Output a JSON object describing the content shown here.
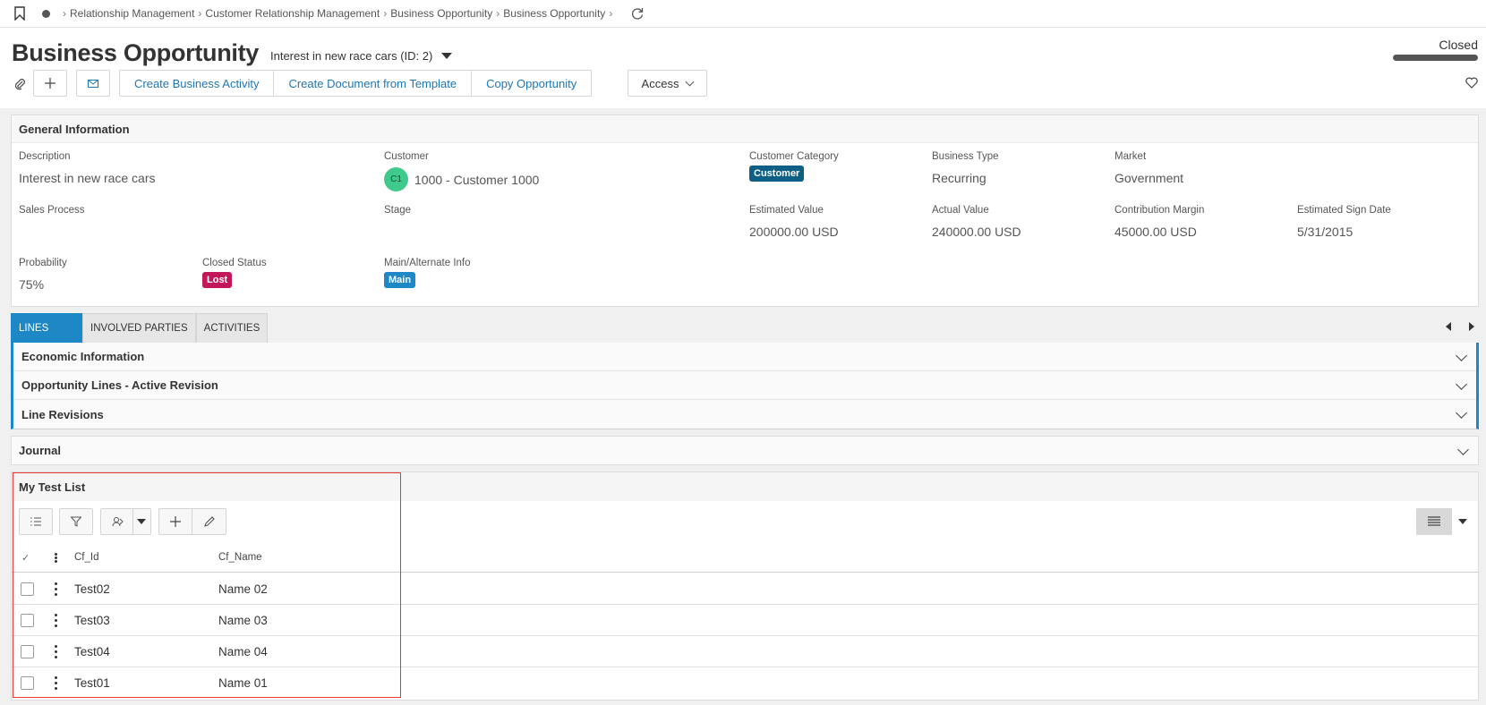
{
  "breadcrumb": {
    "items": [
      "Relationship Management",
      "Customer Relationship Management",
      "Business Opportunity",
      "Business Opportunity"
    ]
  },
  "page": {
    "title": "Business Opportunity",
    "subtitle": "Interest in new race cars (ID: 2)",
    "status": "Closed"
  },
  "toolbar": {
    "create_activity": "Create Business Activity",
    "create_document": "Create Document from Template",
    "copy_opportunity": "Copy Opportunity",
    "access": "Access"
  },
  "general": {
    "title": "General Information",
    "description_label": "Description",
    "description_value": "Interest in new race cars",
    "customer_label": "Customer",
    "customer_avatar": "C1",
    "customer_value": "1000 - Customer 1000",
    "customer_category_label": "Customer Category",
    "customer_category_value": "Customer",
    "business_type_label": "Business Type",
    "business_type_value": "Recurring",
    "market_label": "Market",
    "market_value": "Government",
    "sales_process_label": "Sales Process",
    "stage_label": "Stage",
    "estimated_value_label": "Estimated Value",
    "estimated_value": "200000.00 USD",
    "actual_value_label": "Actual Value",
    "actual_value": "240000.00 USD",
    "contribution_margin_label": "Contribution Margin",
    "contribution_margin": "45000.00 USD",
    "estimated_sign_date_label": "Estimated Sign Date",
    "estimated_sign_date": "5/31/2015",
    "probability_label": "Probability",
    "probability_value": "75%",
    "closed_status_label": "Closed Status",
    "closed_status_value": "Lost",
    "main_alt_label": "Main/Alternate Info",
    "main_alt_value": "Main"
  },
  "tabs": [
    "LINES",
    "INVOLVED PARTIES",
    "ACTIVITIES"
  ],
  "lines_sections": [
    "Economic Information",
    "Opportunity Lines - Active Revision",
    "Line Revisions"
  ],
  "journal": {
    "title": "Journal"
  },
  "test_list": {
    "title": "My Test List",
    "columns": [
      "Cf_Id",
      "Cf_Name"
    ],
    "rows": [
      {
        "id": "Test02",
        "name": "Name 02"
      },
      {
        "id": "Test03",
        "name": "Name 03"
      },
      {
        "id": "Test04",
        "name": "Name 04"
      },
      {
        "id": "Test01",
        "name": "Name 01"
      }
    ]
  },
  "colors": {
    "accent": "#1e88c7",
    "link": "#1f76b5",
    "badge_customer": "#0e5f85",
    "badge_lost": "#c2185b",
    "badge_main": "#1e88c7",
    "avatar": "#3fca8c",
    "highlight": "#e53935"
  },
  "icons": [
    "bookmark-icon",
    "home-dot-icon",
    "refresh-icon",
    "paperclip-icon",
    "plus-icon",
    "mail-icon",
    "heart-icon",
    "list-icon",
    "filter-icon",
    "group-icon",
    "edit-icon",
    "table-view-icon"
  ]
}
